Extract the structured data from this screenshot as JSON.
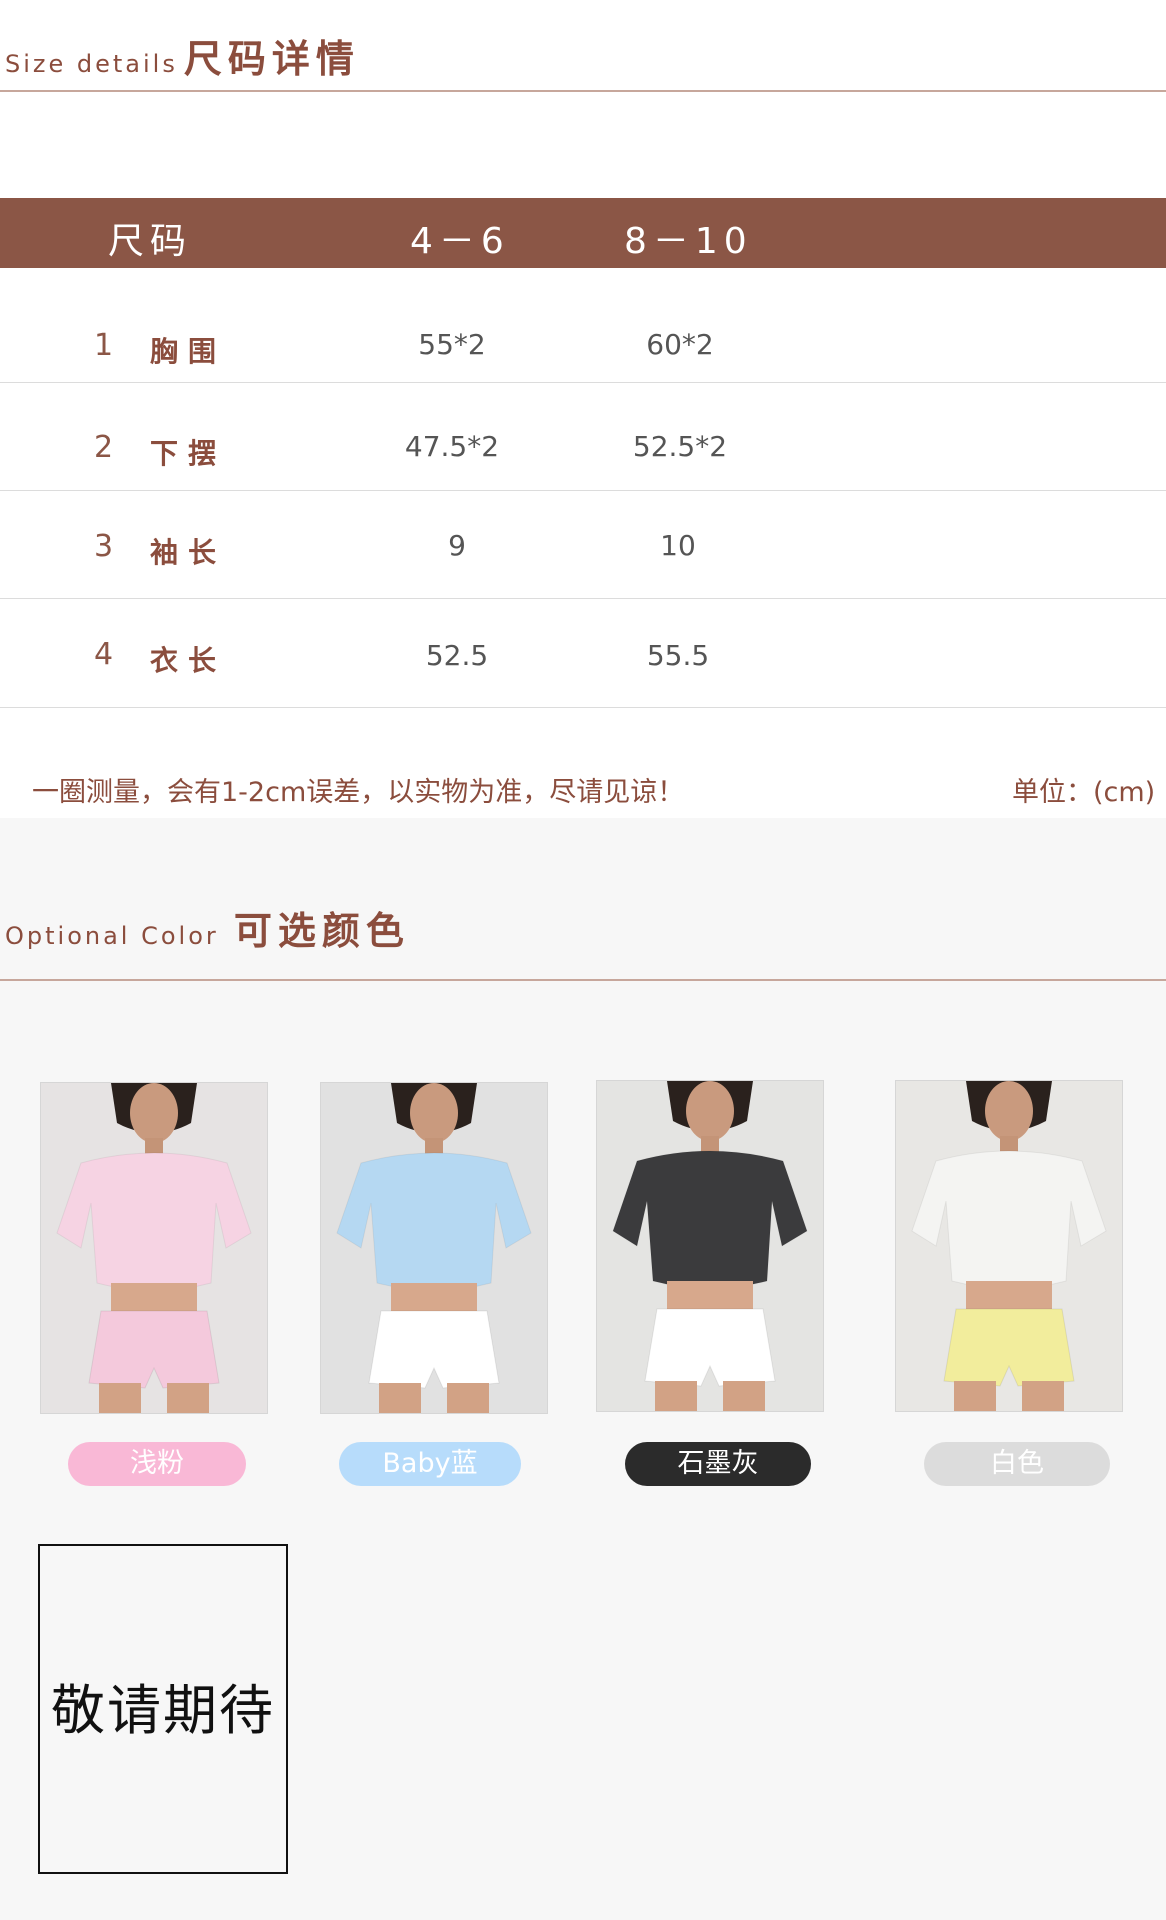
{
  "size_section": {
    "title_en": "Size details",
    "title_zh": "尺码详情"
  },
  "size_table": {
    "headers": [
      "尺码",
      "4－6",
      "8－10"
    ],
    "rows": [
      {
        "num": "1",
        "label": "胸围",
        "v1": "55*2",
        "v2": "60*2"
      },
      {
        "num": "2",
        "label": "下摆",
        "v1": "47.5*2",
        "v2": "52.5*2"
      },
      {
        "num": "3",
        "label": "袖长",
        "v1": "9",
        "v2": "10"
      },
      {
        "num": "4",
        "label": "衣长",
        "v1": "52.5",
        "v2": "55.5"
      }
    ]
  },
  "note": {
    "text": "一圈测量，会有1-2cm误差，以实物为准，尽请见谅！",
    "unit": "单位：(cm)"
  },
  "color_section": {
    "title_en": "Optional Color",
    "title_zh": "可选颜色"
  },
  "colors": [
    {
      "name": "浅粉",
      "pill_bg": "#f9b8d6",
      "pill_fg": "#ffffff",
      "shirt": "#f6d3e3",
      "shorts": "#f4c9dc"
    },
    {
      "name": "Baby蓝",
      "pill_bg": "#b7dcfb",
      "pill_fg": "#ffffff",
      "shirt": "#b5d8f2",
      "shorts": "#ffffff"
    },
    {
      "name": "石墨灰",
      "pill_bg": "#2b2b2b",
      "pill_fg": "#ffffff",
      "shirt": "#3b3b3d",
      "shorts": "#ffffff"
    },
    {
      "name": "白色",
      "pill_bg": "#dcdcdc",
      "pill_fg": "#ffffff",
      "shirt": "#f4f4f2",
      "shorts": "#f2ed9c"
    }
  ],
  "coming_soon": "敬请期待"
}
